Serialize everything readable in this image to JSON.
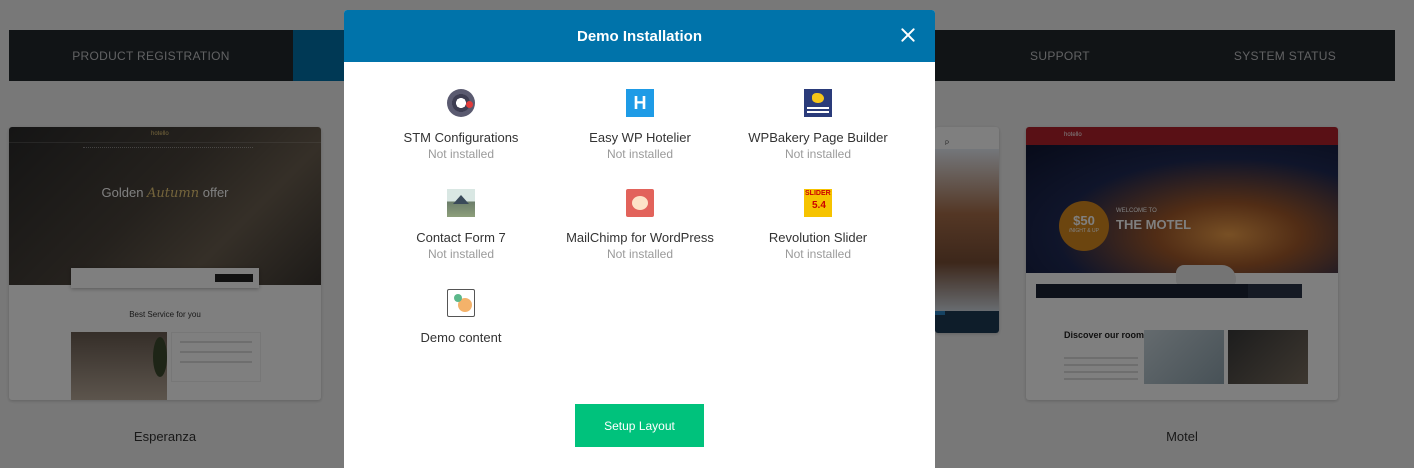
{
  "background": {
    "nav": {
      "items": [
        {
          "label": "PRODUCT REGISTRATION",
          "active": false
        },
        {
          "label": "",
          "active": true
        },
        {
          "label": "",
          "active": false
        },
        {
          "label": "",
          "active": false
        },
        {
          "label": "SUPPORT",
          "active": false
        },
        {
          "label": "SYSTEM STATUS",
          "active": false
        }
      ]
    },
    "layouts": [
      {
        "name": "Esperanza",
        "thumb": {
          "logo": "hotello",
          "title_start": "Golden ",
          "title_accent": "Autumn",
          "title_end": " offer",
          "subtitle": "Best Service for you"
        }
      },
      {
        "name": "Motel",
        "thumb": {
          "logo": "hotello",
          "badge_price": "$50",
          "badge_sub": "/NIGHT & UP",
          "welcome": "WELCOME TO",
          "hotel_name": "THE MOTEL",
          "rooms_title": "Discover our rooms"
        }
      }
    ],
    "mid_card_letter": "P"
  },
  "modal": {
    "title": "Demo Installation",
    "close_icon": "close-icon",
    "plugins": [
      {
        "name": "STM Configurations",
        "status": "Not installed",
        "icon": "stm-configurations-icon"
      },
      {
        "name": "Easy WP Hotelier",
        "status": "Not installed",
        "icon": "hotelier-icon",
        "glyph": "H"
      },
      {
        "name": "WPBakery Page Builder",
        "status": "Not installed",
        "icon": "wpbakery-icon"
      },
      {
        "name": "Contact Form 7",
        "status": "Not installed",
        "icon": "contact-form-icon"
      },
      {
        "name": "MailChimp for WordPress",
        "status": "Not installed",
        "icon": "mailchimp-icon"
      },
      {
        "name": "Revolution Slider",
        "status": "Not installed",
        "icon": "revolution-slider-icon"
      },
      {
        "name": "Demo content",
        "status": "",
        "icon": "demo-content-icon"
      }
    ],
    "setup_button": "Setup Layout"
  },
  "colors": {
    "header_blue": "#0073aa",
    "setup_green": "#00c27c",
    "nav_dark": "#23282d",
    "status_gray": "#9a9a9a"
  }
}
